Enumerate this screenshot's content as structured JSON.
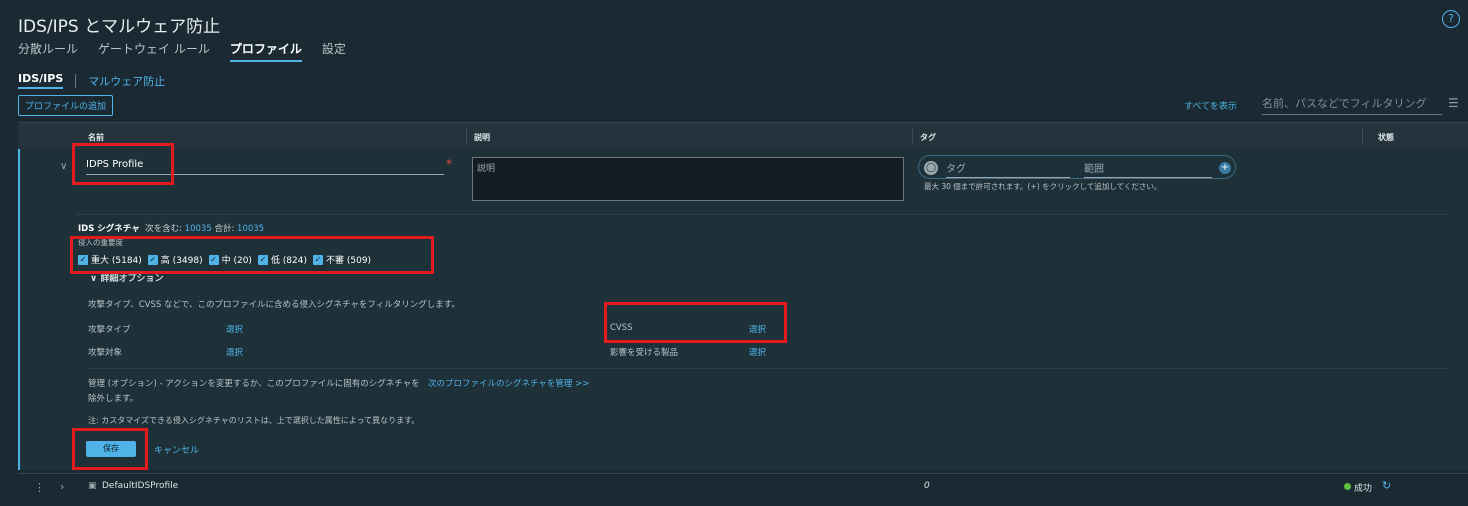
{
  "header": {
    "title": "IDS/IPS とマルウェア防止",
    "help_icon": "?"
  },
  "tabs": [
    {
      "label": "分散ルール",
      "active": false
    },
    {
      "label": "ゲートウェイ ルール",
      "active": false
    },
    {
      "label": "プロファイル",
      "active": true
    },
    {
      "label": "設定",
      "active": false
    }
  ],
  "subtabs": [
    {
      "label": "IDS/IPS",
      "active": true
    },
    {
      "label": "マルウェア防止",
      "active": false
    }
  ],
  "toolbar": {
    "add_profile_label": "プロファイルの追加",
    "show_all_label": "すべてを表示",
    "filter_placeholder": "名前、パスなどでフィルタリング"
  },
  "table": {
    "columns": [
      "名前",
      "説明",
      "タグ",
      "状態"
    ]
  },
  "edit_row": {
    "name_value": "IDPS Profile",
    "required_mark": "*",
    "description_placeholder": "説明",
    "tag_placeholder": "タグ",
    "scope_placeholder": "範囲",
    "tag_hint": "最大 30 個まで許可されます。(+) をクリックして追加してください。",
    "signatures": {
      "label": "IDS シグネチャ",
      "included_label": "次を含む:",
      "included_value": "10035",
      "total_label": "合計:",
      "total_value": "10035"
    },
    "severity_label": "侵入の重要度",
    "severities": [
      {
        "label": "重大 (5184)",
        "checked": true
      },
      {
        "label": "高 (3498)",
        "checked": true
      },
      {
        "label": "中 (20)",
        "checked": true
      },
      {
        "label": "低 (824)",
        "checked": true
      },
      {
        "label": "不審 (509)",
        "checked": true
      }
    ],
    "advanced_label": "∨ 詳細オプション",
    "advanced_desc": "攻撃タイプ、CVSS などで、このプロファイルに含める侵入シグネチャをフィルタリングします。",
    "filters": [
      {
        "label": "攻撃タイプ",
        "action": "選択"
      },
      {
        "label": "攻撃対象",
        "action": "選択"
      },
      {
        "label": "CVSS",
        "action": "選択"
      },
      {
        "label": "影響を受ける製品",
        "action": "選択"
      }
    ],
    "manage_text": "管理 (オプション) - アクションを変更するか、このプロファイルに固有のシグネチャを除外します。",
    "manage_link": "次のプロファイルのシグネチャを管理 >>",
    "note": "注: カスタマイズできる侵入シグネチャのリストは、上で選択した属性によって異なります。",
    "save_label": "保存",
    "cancel_label": "キャンセル"
  },
  "rows": [
    {
      "name": "DefaultIDSProfile",
      "tags": "0",
      "status": "成功"
    }
  ],
  "colors": {
    "accent": "#4fb3e8",
    "highlight": "#e21c1c",
    "success": "#5fbf3f"
  }
}
